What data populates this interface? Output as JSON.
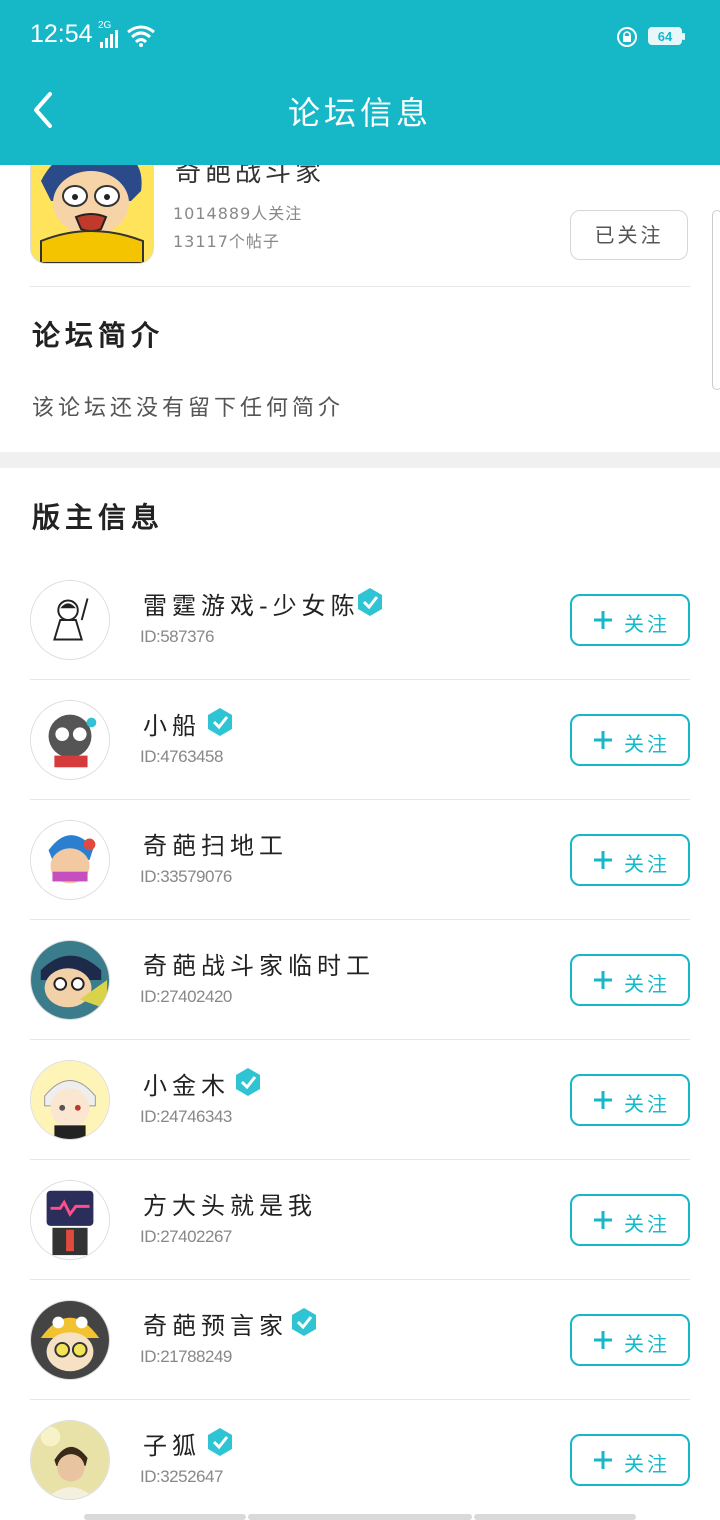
{
  "status_bar": {
    "time": "12:54",
    "network": "2G",
    "battery": "64"
  },
  "header": {
    "title": "论坛信息"
  },
  "forum": {
    "name": "奇葩战斗家",
    "followers": "1014889人关注",
    "posts": "13117个帖子",
    "follow_state": "已关注"
  },
  "intro": {
    "heading": "论坛简介",
    "text": "该论坛还没有留下任何简介"
  },
  "moderators": {
    "heading": "版主信息",
    "follow_label": "关注",
    "items": [
      {
        "name": "雷霆游戏-少女陈",
        "id": "ID:587376",
        "verified": true
      },
      {
        "name": "小船",
        "id": "ID:4763458",
        "verified": true
      },
      {
        "name": "奇葩扫地工",
        "id": "ID:33579076",
        "verified": false
      },
      {
        "name": "奇葩战斗家临时工",
        "id": "ID:27402420",
        "verified": false
      },
      {
        "name": "小金木",
        "id": "ID:24746343",
        "verified": true
      },
      {
        "name": "方大头就是我",
        "id": "ID:27402267",
        "verified": false
      },
      {
        "name": "奇葩预言家",
        "id": "ID:21788249",
        "verified": true
      },
      {
        "name": "子狐",
        "id": "ID:3252647",
        "verified": true
      }
    ]
  },
  "colors": {
    "accent": "#16b8c8",
    "divider": "#e6e6e6"
  }
}
